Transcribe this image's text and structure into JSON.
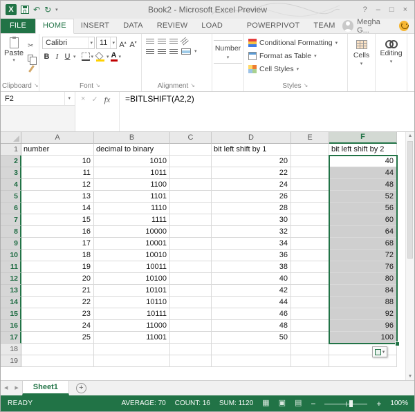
{
  "window": {
    "title": "Book2 - Microsoft Excel Preview",
    "controls": {
      "help": "?",
      "minimize": "–",
      "restore": "□",
      "close": "×"
    }
  },
  "ribbon": {
    "tabs": [
      {
        "label": "FILE",
        "type": "file"
      },
      {
        "label": "HOME",
        "active": true
      },
      {
        "label": "INSERT"
      },
      {
        "label": "DATA"
      },
      {
        "label": "REVIEW"
      },
      {
        "label": "LOAD TEST"
      },
      {
        "label": "POWERPIVOT"
      },
      {
        "label": "TEAM"
      }
    ],
    "user_name": "Megha G...",
    "clipboard": {
      "label": "Clipboard",
      "paste": "Paste"
    },
    "font": {
      "label": "Font",
      "font_name": "Calibri",
      "font_size": "11",
      "bold": "B",
      "italic": "I",
      "underline": "U"
    },
    "alignment": {
      "label": "Alignment"
    },
    "number": {
      "label": "Number"
    },
    "styles": {
      "label": "Styles",
      "items": [
        "Conditional Formatting",
        "Format as Table",
        "Cell Styles"
      ]
    },
    "cells": {
      "label": "Cells"
    },
    "editing": {
      "label": "Editing"
    }
  },
  "formula_bar": {
    "name_box": "F2",
    "cancel": "×",
    "enter": "✓",
    "fx": "fx",
    "formula": "=BITLSHIFT(A2,2)"
  },
  "sheet": {
    "column_headers": [
      "A",
      "B",
      "C",
      "D",
      "E",
      "F"
    ],
    "rows": [
      [
        "number",
        "decimal to binary",
        "",
        "bit left shift by 1",
        "",
        "bit left shift by 2"
      ],
      [
        "10",
        "1010",
        "",
        "20",
        "",
        "40"
      ],
      [
        "11",
        "1011",
        "",
        "22",
        "",
        "44"
      ],
      [
        "12",
        "1100",
        "",
        "24",
        "",
        "48"
      ],
      [
        "13",
        "1101",
        "",
        "26",
        "",
        "52"
      ],
      [
        "14",
        "1110",
        "",
        "28",
        "",
        "56"
      ],
      [
        "15",
        "1111",
        "",
        "30",
        "",
        "60"
      ],
      [
        "16",
        "10000",
        "",
        "32",
        "",
        "64"
      ],
      [
        "17",
        "10001",
        "",
        "34",
        "",
        "68"
      ],
      [
        "18",
        "10010",
        "",
        "36",
        "",
        "72"
      ],
      [
        "19",
        "10011",
        "",
        "38",
        "",
        "76"
      ],
      [
        "20",
        "10100",
        "",
        "40",
        "",
        "80"
      ],
      [
        "21",
        "10101",
        "",
        "42",
        "",
        "84"
      ],
      [
        "22",
        "10110",
        "",
        "44",
        "",
        "88"
      ],
      [
        "23",
        "10111",
        "",
        "46",
        "",
        "92"
      ],
      [
        "24",
        "11000",
        "",
        "48",
        "",
        "96"
      ],
      [
        "25",
        "11001",
        "",
        "50",
        "",
        "100"
      ],
      [
        "",
        "",
        "",
        "",
        "",
        ""
      ],
      [
        "",
        "",
        "",
        "",
        "",
        ""
      ]
    ],
    "selection": {
      "range": "F2:F17",
      "active_cell": "F2",
      "column": "F",
      "row_start": 2,
      "row_end": 17
    }
  },
  "sheet_tabs": {
    "active": "Sheet1"
  },
  "status_bar": {
    "mode": "READY",
    "average": "AVERAGE: 70",
    "count": "COUNT: 16",
    "sum": "SUM: 1120",
    "zoom": "100%"
  },
  "colors": {
    "accent": "#217346",
    "selection_fill": "#cfcfcf",
    "status_bar": "#217346"
  }
}
